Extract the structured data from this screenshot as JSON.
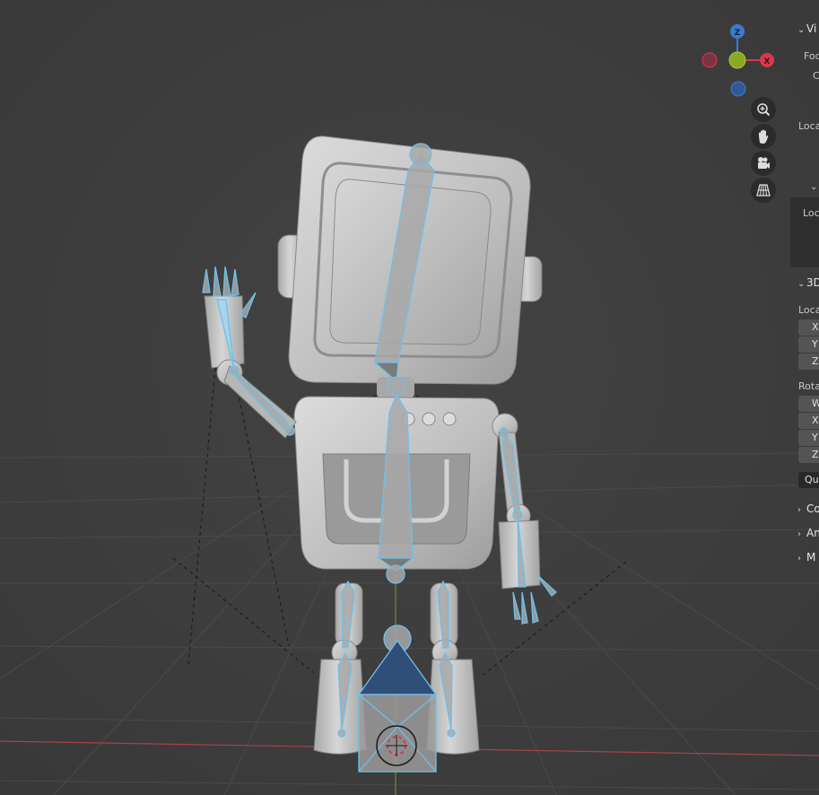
{
  "gizmo": {
    "z_label": "Z",
    "x_label": "X",
    "colors": {
      "z": "#3b7bd0",
      "x": "#d9384a",
      "y": "#8aa822",
      "neg_x": "#7e3440",
      "neg_z": "#2f5a96"
    }
  },
  "nav_buttons": [
    {
      "name": "zoom-icon"
    },
    {
      "name": "pan-hand-icon"
    },
    {
      "name": "camera-icon"
    },
    {
      "name": "grid-perspective-icon"
    }
  ],
  "npanel": {
    "view_header": "Vi",
    "focal_label": "Foc",
    "clip_label": "C",
    "local_camera_label": "Loca",
    "collection_local_label": "Loc",
    "cursor_header": "3D",
    "location_label": "Loca",
    "loc_fields": [
      "X",
      "Y",
      "Z"
    ],
    "rotation_label": "Rota",
    "rot_fields": [
      "W",
      "X",
      "Y",
      "Z"
    ],
    "rotation_mode": "Qua",
    "collapsed_sections": [
      "Co",
      "An",
      "M"
    ]
  },
  "scene": {
    "accent": "#6fc0ea",
    "selected_bone_fill": "#2f4e78",
    "robot_fill": "#c9c9c9"
  }
}
